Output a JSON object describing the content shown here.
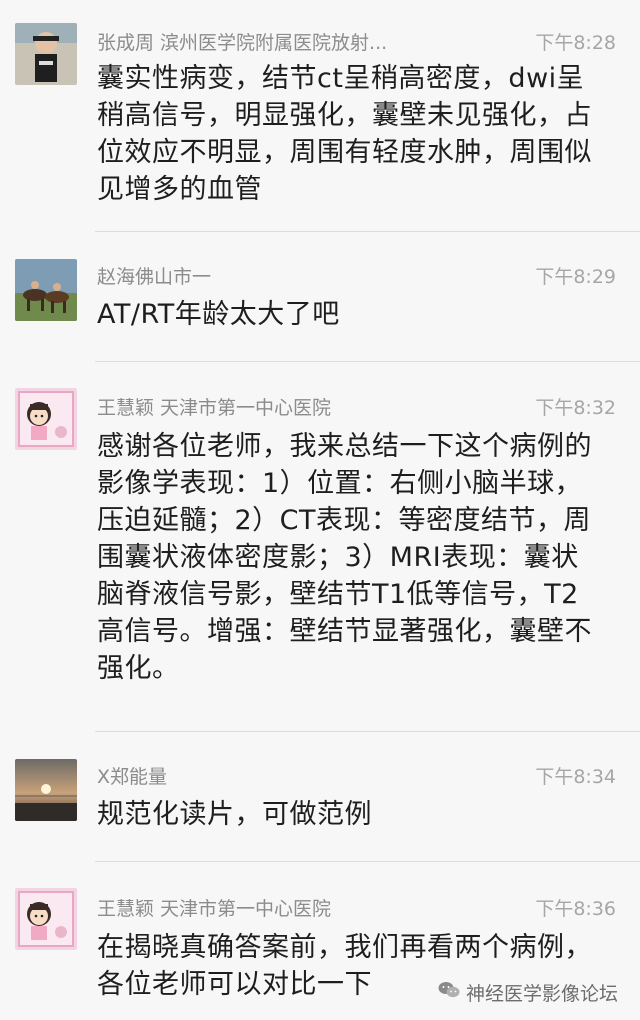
{
  "messages": [
    {
      "name": "张成周 滨州医学院附属医院放射...",
      "time": "下午8:28",
      "text": "囊实性病变，结节ct呈稍高密度，dwi呈\n稍高信号，明显强化，囊壁未见强化，占\n位效应不明显，周围有轻度水肿，周围似\n见增多的血管",
      "avatar": "child-photo"
    },
    {
      "name": "赵海佛山市一",
      "time": "下午8:29",
      "text": "AT/RT年龄太大了吧",
      "avatar": "horses-photo"
    },
    {
      "name": "王慧颖 天津市第一中心医院",
      "time": "下午8:32",
      "text": "感谢各位老师，我来总结一下这个病例的\n影像学表现：1）位置：右侧小脑半球，\n压迫延髓；2）CT表现：等密度结节，周\n围囊状液体密度影；3）MRI表现：囊状\n脑脊液信号影，壁结节T1低等信号，T2\n高信号。增强：壁结节显著强化，囊壁不\n强化。",
      "avatar": "cartoon-girl"
    },
    {
      "name": "X郑能量",
      "time": "下午8:34",
      "text": "规范化读片，可做范例",
      "avatar": "sunset-photo"
    },
    {
      "name": "王慧颖 天津市第一中心医院",
      "time": "下午8:36",
      "text": "在揭晓真确答案前，我们再看两个病例，\n各位老师可以对比一下",
      "avatar": "cartoon-girl"
    }
  ],
  "watermark": {
    "text": "神经医学影像论坛",
    "icon": "wechat-icon"
  }
}
